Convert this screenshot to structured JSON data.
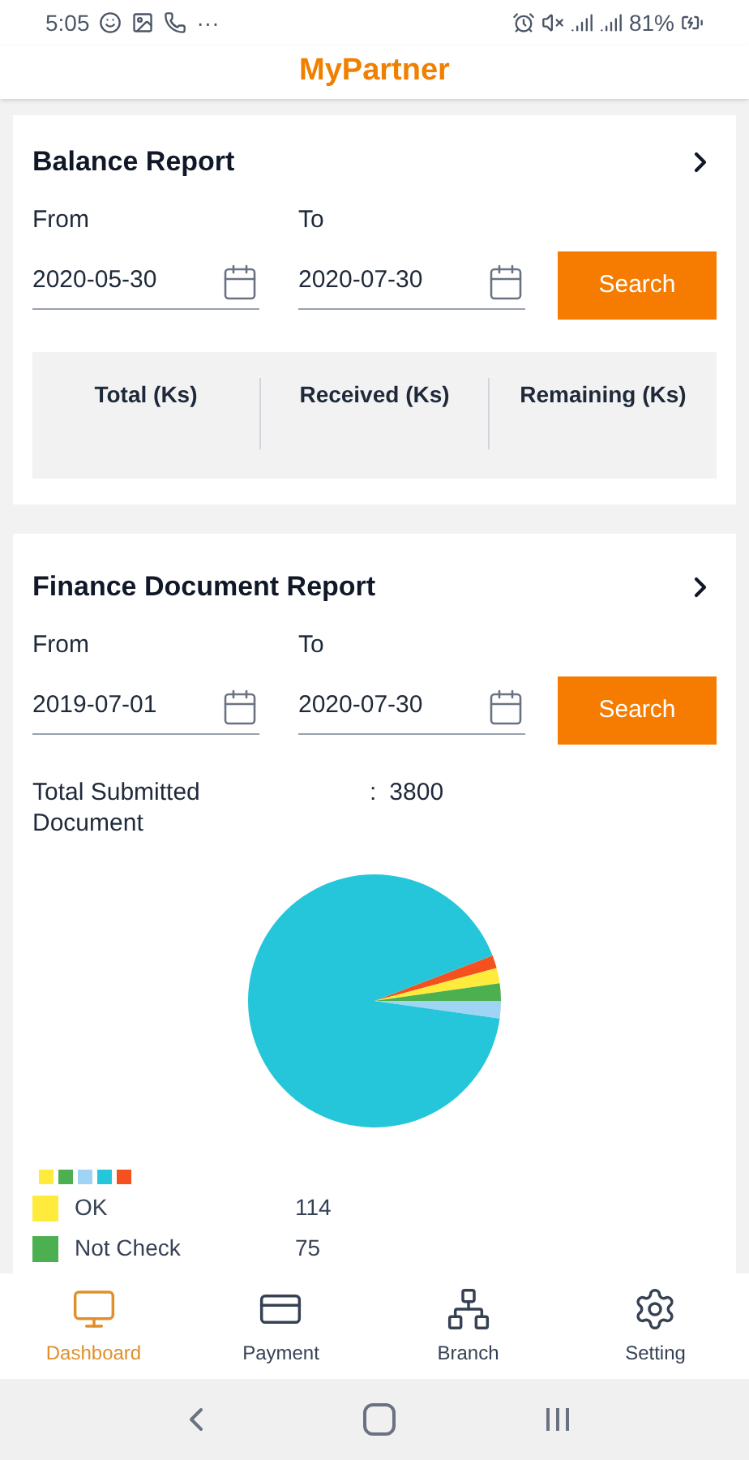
{
  "status_bar": {
    "time": "5:05",
    "more": "···",
    "battery": "81%"
  },
  "app_title": "MyPartner",
  "balance_report": {
    "title": "Balance Report",
    "from_label": "From",
    "to_label": "To",
    "from_value": "2020-05-30",
    "to_value": "2020-07-30",
    "search_button": "Search",
    "columns": [
      "Total (Ks)",
      "Received (Ks)",
      "Remaining (Ks)"
    ]
  },
  "finance_report": {
    "title": "Finance Document Report",
    "from_label": "From",
    "to_label": "To",
    "from_value": "2019-07-01",
    "to_value": "2020-07-30",
    "search_button": "Search",
    "total_label": "Total Submitted Document",
    "total_separator": ":",
    "total_value": "3800",
    "legend_swatches": [
      {
        "color": "#ffeb3b"
      },
      {
        "color": "#4caf50"
      },
      {
        "color": "#9fd4f5"
      },
      {
        "color": "#26c6da"
      },
      {
        "color": "#f4511e"
      }
    ],
    "legend": [
      {
        "label": "OK",
        "value": "114",
        "color": "#ffeb3b"
      },
      {
        "label": "Not Check",
        "value": "75",
        "color": "#4caf50"
      }
    ]
  },
  "bottom_nav": [
    {
      "label": "Dashboard",
      "kind": "dashboard",
      "selected": true
    },
    {
      "label": "Payment",
      "kind": "payment",
      "selected": false
    },
    {
      "label": "Branch",
      "kind": "branch",
      "selected": false
    },
    {
      "label": "Setting",
      "kind": "setting",
      "selected": false
    }
  ]
}
